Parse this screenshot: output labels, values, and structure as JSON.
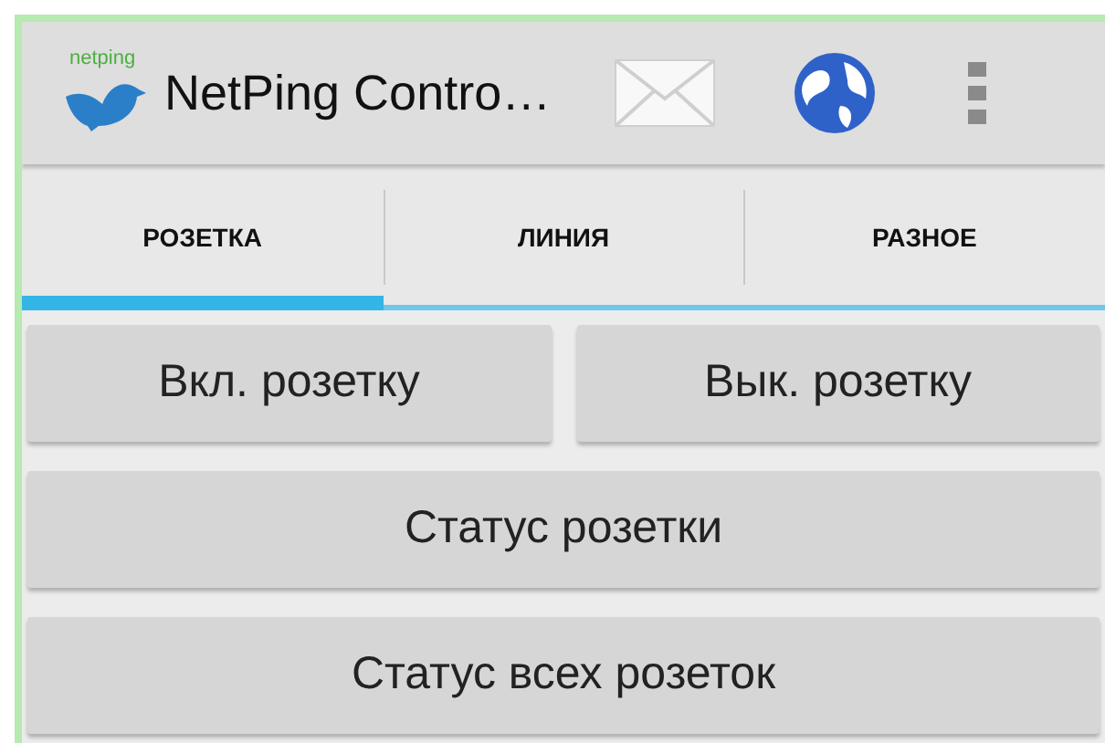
{
  "app_bar": {
    "logo_text": "netping",
    "title": "NetPing Contro…"
  },
  "tabs": [
    {
      "label": "РОЗЕТКА",
      "selected": true
    },
    {
      "label": "ЛИНИЯ",
      "selected": false
    },
    {
      "label": "РАЗНОЕ",
      "selected": false
    }
  ],
  "button_rows": [
    [
      "Вкл. розетку",
      "Вык. розетку"
    ],
    [
      "Статус розетки"
    ],
    [
      "Статус всех розеток"
    ]
  ]
}
